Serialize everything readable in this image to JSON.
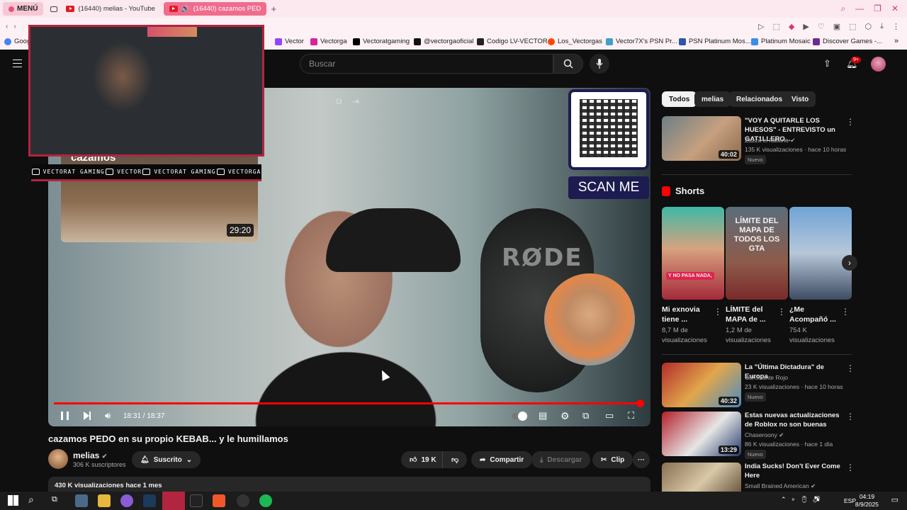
{
  "browser": {
    "menu_label": "MENÚ",
    "tabs": [
      {
        "title": "(16440) melias - YouTube"
      },
      {
        "title": "(16440) cazamos PED"
      }
    ],
    "add_tab": "+"
  },
  "bookmarks": [
    "Goog",
    "Vector",
    "Vectorga",
    "Vectoratgaming",
    "@vectorgaoficial",
    "Codigo LV-VECTOR",
    "Los_Vectorgas",
    "Vector7X's PSN Pr...",
    "PSN Platinum Mos...",
    "Platinum Mosaic",
    "Discover Games -..."
  ],
  "youtube": {
    "search_placeholder": "Buscar",
    "notifications_badge": "9+"
  },
  "player": {
    "time": "18:31 / 18:37",
    "progress": 0.995,
    "qr_label": "SCAN ME",
    "mic_brand": "RØDE",
    "overlay_card": {
      "title": "cazamos",
      "duration": "29:20"
    },
    "social_bar": [
      {
        "text": "VECTORAT GAMING"
      },
      {
        "text": "VECTOR"
      },
      {
        "text": "VECTORAT GAMING"
      },
      {
        "text": "VECTORGA"
      }
    ]
  },
  "video": {
    "title": "cazamos PEDO en su propio KEBAB... y le humillamos",
    "channel": "melias",
    "subscribers": "306 K suscriptores",
    "subscribed_label": "Suscrito",
    "likes": "19 K",
    "share_label": "Compartir",
    "download_label": "Descargar",
    "clip_label": "Clip",
    "description_meta": "430 K visualizaciones  hace 1 mes"
  },
  "sidebar": {
    "chips": [
      "Todos",
      "melias",
      "Relacionados",
      "Visto"
    ],
    "recommendations": [
      {
        "title": "\"VOY A QUITARLE LOS HUESOS\" - ENTREVISTO un GAT1LLERO...",
        "channel": "Zazza el Italiano",
        "meta": "135 K visualizaciones · hace 10 horas",
        "badge": "Nuevo",
        "duration": "40:02"
      },
      {
        "title": "La \"Última Dictadura\" de Europa",
        "channel": "Caminante Rojo",
        "meta": "23 K visualizaciones · hace 10 horas",
        "badge": "Nuevo",
        "duration": "40:32"
      },
      {
        "title": "Estas nuevas actualizaciones de Roblox no son buenas",
        "channel": "Chaseroony",
        "meta": "86 K visualizaciones · hace 1 día",
        "badge": "Nuevo",
        "duration": "13:29"
      },
      {
        "title": "India Sucks! Don't Ever Come Here",
        "channel": "Small Brained American",
        "meta": "",
        "badge": "",
        "duration": ""
      }
    ],
    "shorts_heading": "Shorts",
    "shorts": [
      {
        "title": "Mi exnovia tiene ...",
        "views": "8,7 M de visualizaciones",
        "overlay": "Y NO PASA NADA,"
      },
      {
        "title": "LÍMITE del MAPA de ...",
        "views": "1,2 M de visualizaciones",
        "overlay": "LÍMITE DEL MAPA DE TODOS LOS GTA"
      },
      {
        "title": "¿Me Acompañó ...",
        "views": "754 K visualizaciones",
        "overlay": ""
      }
    ]
  },
  "taskbar": {
    "language": "ESP",
    "time": "04:19",
    "date": "8/9/2025"
  }
}
